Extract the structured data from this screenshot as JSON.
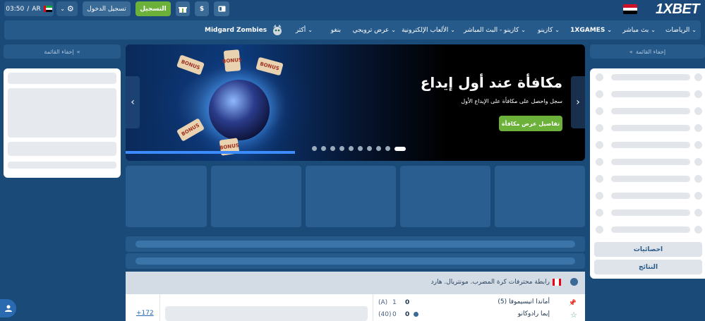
{
  "brand": {
    "logo": "1XBET",
    "accent": "#6cb23a",
    "primary": "#1b4a7a"
  },
  "topbar": {
    "register_label": "التسجيل",
    "login_label": "تسجيل الدخول",
    "time": "03:50",
    "lang": "AR",
    "separator": "/",
    "currency_symbol": "$"
  },
  "nav": {
    "items": [
      {
        "label": "الرياضات"
      },
      {
        "label": "بث مباشر"
      },
      {
        "label": "1XGAMES"
      },
      {
        "label": "كازينو"
      },
      {
        "label": "كازينو - البث المباشر"
      },
      {
        "label": "الألعاب الإلكترونية"
      },
      {
        "label": "عرض ترويجي"
      },
      {
        "label": "بنغو"
      },
      {
        "label": "أكثر"
      }
    ],
    "featured": "Midgard Zombies"
  },
  "sidebar": {
    "hide_left": "إخفاء القائمة",
    "hide_right": "إخفاء القائمة"
  },
  "right_panel": {
    "stats_label": "احصائيات",
    "results_label": "النتائج"
  },
  "banner": {
    "title": "مكافأة عند أول إيداع",
    "subtitle": "سجل واحصل على مكافأة على الإيداع الأول",
    "cta": "تفاصيل عرض مكافأة",
    "ticket_text": [
      "BONUS",
      "BONUS",
      "BONUS",
      "BONUS",
      "BONUS"
    ],
    "slides_count": 10,
    "active_slide": 10
  },
  "league": {
    "name": "رابطة محترفات كرة المضرب. مونتريال. هارد"
  },
  "match": {
    "team1": "أماندا انيسيموفا (5)",
    "team2": "إيما رادوكانو",
    "score1_a": "0",
    "score1_b": "1",
    "score1_c": "(A)",
    "score2_a": "0",
    "score2_b": "0",
    "score2_c": "(40)",
    "more": "+172"
  }
}
